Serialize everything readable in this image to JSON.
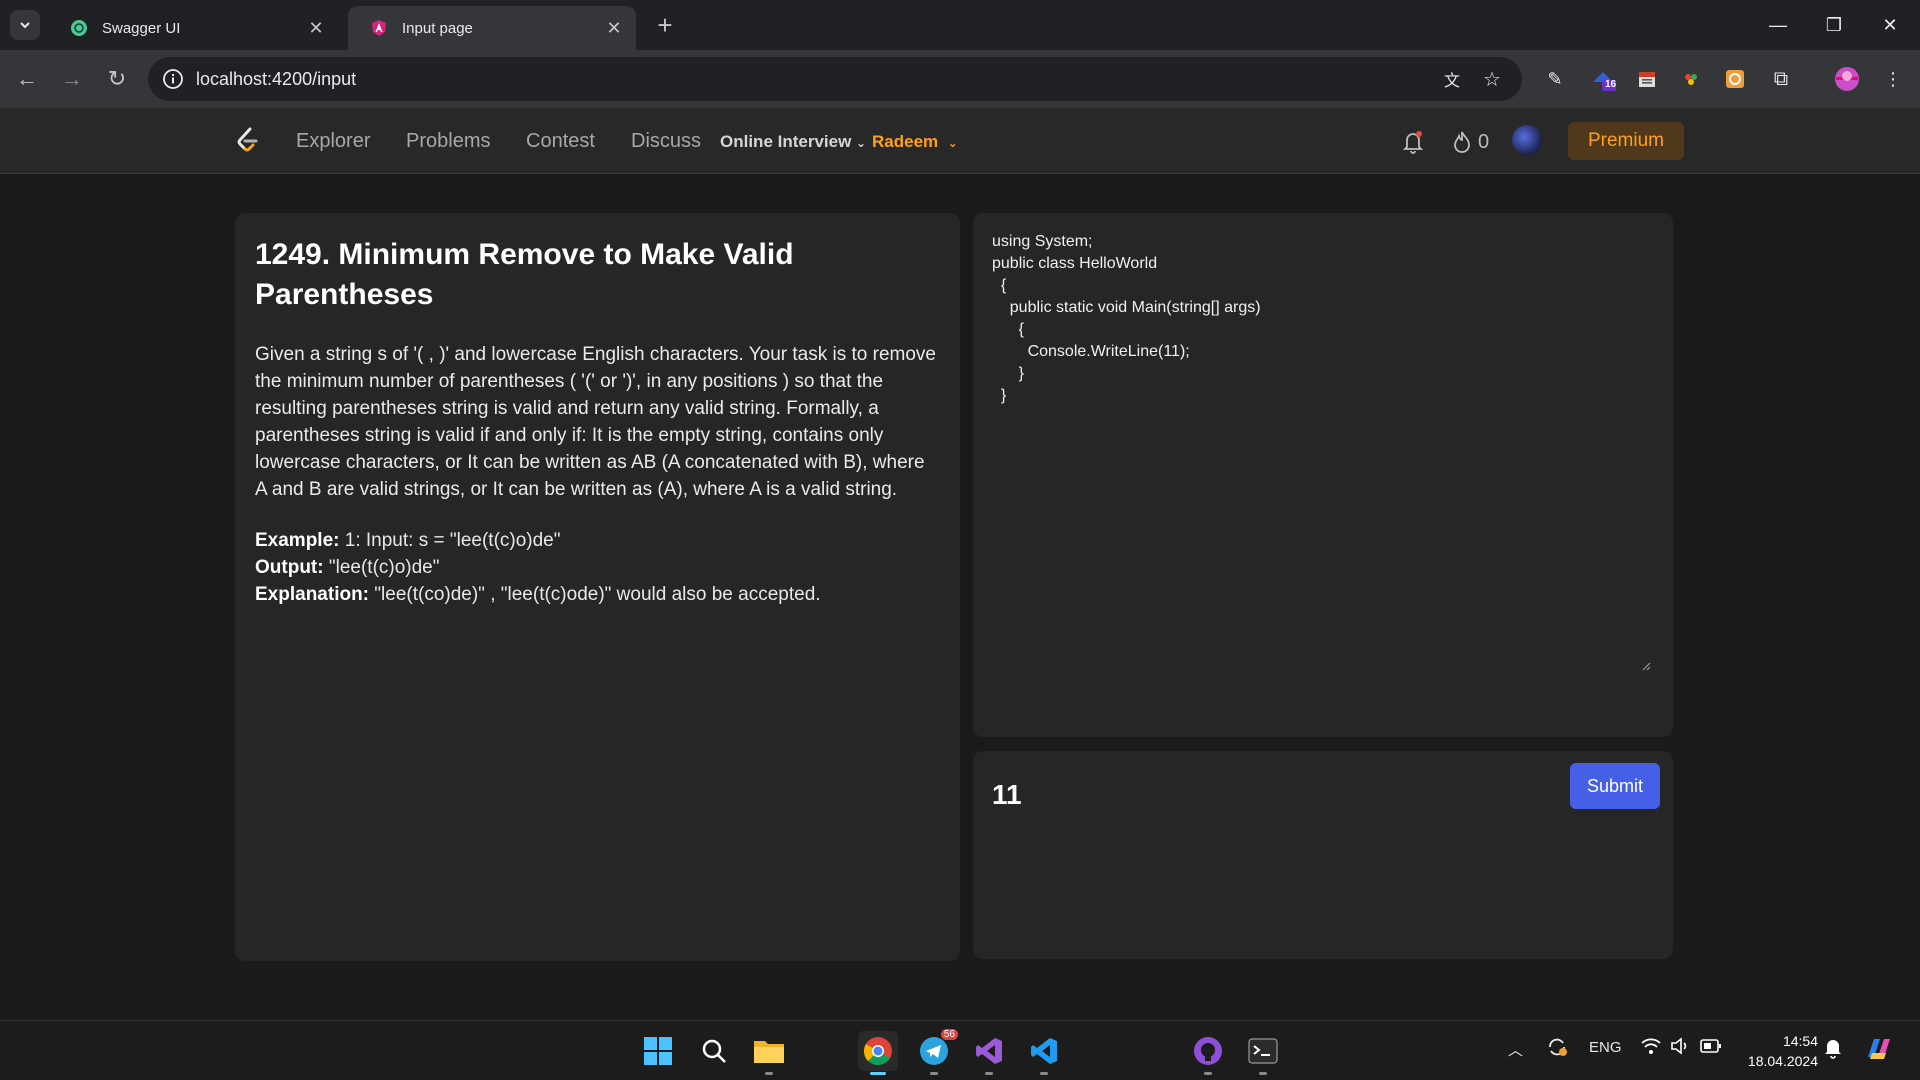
{
  "browser": {
    "tabs": [
      {
        "title": "Swagger UI",
        "favicon": "swagger-icon",
        "active": false
      },
      {
        "title": "Input page",
        "favicon": "angular-icon",
        "active": true
      }
    ],
    "url": "localhost:4200/input",
    "extension_badge": "16"
  },
  "site": {
    "nav": {
      "links": [
        "Explorer",
        "Problems",
        "Contest",
        "Discuss"
      ],
      "online_interview": "Online Interview",
      "user": "Radeem",
      "streak": "0",
      "premium": "Premium"
    },
    "problem": {
      "title": "1249. Minimum Remove to Make Valid Parentheses",
      "description": "Given a string s of '( , )' and lowercase English characters. Your task is to remove the minimum number of parentheses ( '(' or ')', in any positions ) so that the resulting parentheses string is valid and return any valid string. Formally, a parentheses string is valid if and only if: It is the empty string, contains only lowercase characters, or It can be written as AB (A concatenated with B), where A and B are valid strings, or It can be written as (A), where A is a valid string.",
      "example_label": "Example:",
      "example_text": " 1: Input: s = \"lee(t(c)o)de\"",
      "output_label": "Output:",
      "output_text": " \"lee(t(c)o)de\"",
      "explanation_label": "Explanation:",
      "explanation_text": " \"lee(t(co)de)\" , \"lee(t(c)ode)\" would also be accepted."
    },
    "editor": {
      "code": "using System;\npublic class HelloWorld\n  {\n    public static void Main(string[] args)\n      {\n        Console.WriteLine(11);\n      }\n  }"
    },
    "output": {
      "value": "11",
      "submit_label": "Submit"
    }
  },
  "taskbar": {
    "telegram_badge": "56",
    "language": "ENG",
    "time": "14:54",
    "date": "18.04.2024"
  },
  "colors": {
    "accent_orange": "#ffa116",
    "submit_blue": "#4560e6",
    "panel_bg": "#262626"
  }
}
